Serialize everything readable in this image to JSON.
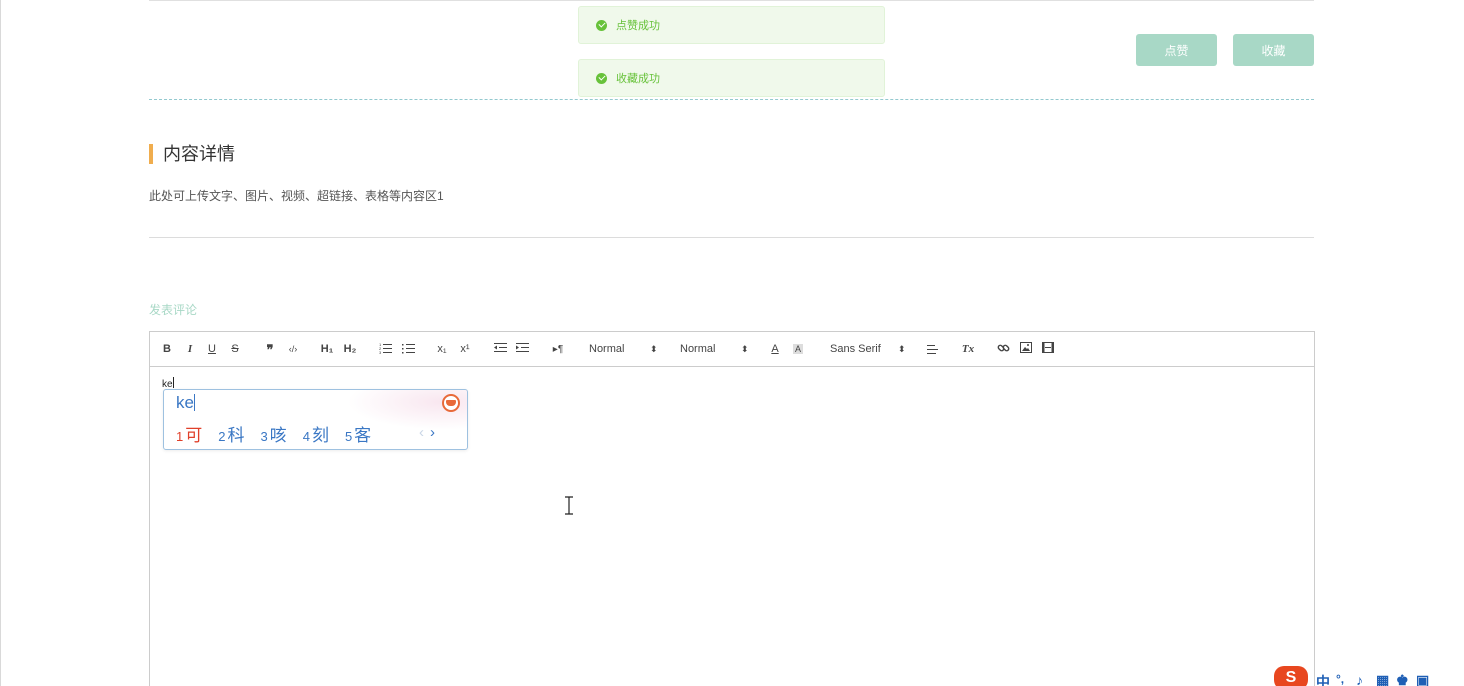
{
  "toasts": {
    "like_success": "点赞成功",
    "collect_success": "收藏成功"
  },
  "actions": {
    "like_label": "点赞",
    "collect_label": "收藏"
  },
  "content": {
    "section_title": "内容详情",
    "description": "此处可上传文字、图片、视频、超链接、表格等内容区1"
  },
  "comment": {
    "label": "发表评论",
    "typed_text": "ke"
  },
  "toolbar": {
    "bold": "B",
    "italic": "I",
    "underline": "U",
    "strike": "S",
    "blockquote": "❞",
    "code": "‹/›",
    "h1": "H₁",
    "h2": "H₂",
    "subscript": "x₁",
    "superscript": "x¹",
    "direction": "▸¶",
    "size_value": "Normal",
    "header_value": "Normal",
    "font_color": "A",
    "background_color": "A",
    "font_value": "Sans Serif",
    "clean": "Tx"
  },
  "ime": {
    "composition": "ke",
    "candidates": [
      {
        "num": "1",
        "text": "可"
      },
      {
        "num": "2",
        "text": "科"
      },
      {
        "num": "3",
        "text": "咳"
      },
      {
        "num": "4",
        "text": "刻"
      },
      {
        "num": "5",
        "text": "客"
      }
    ],
    "prev": "‹",
    "next": "›"
  },
  "taskbar": {
    "ime_logo": "S",
    "mode": "中"
  },
  "colors": {
    "accent_button": "#a8d8c6",
    "success": "#67c23a",
    "section_bar": "#f0ad4e",
    "ime_blue": "#3a77c4",
    "ime_red": "#e0402a"
  }
}
